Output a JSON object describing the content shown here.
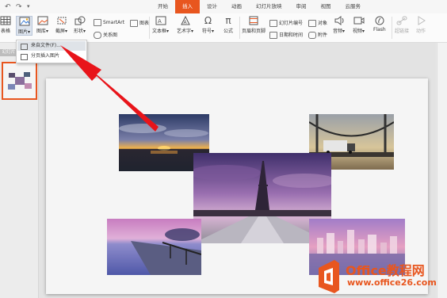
{
  "ribbon_tabs": [
    "开始",
    "插入",
    "设计",
    "动画",
    "幻灯片放映",
    "审阅",
    "视图",
    "云服务"
  ],
  "active_tab": "插入",
  "ribbon": {
    "table": "表格",
    "picture": "图片",
    "gallery": "图库",
    "screenshot": "截屏",
    "shapes": "形状",
    "smartart": "SmartArt",
    "chart": "图表",
    "relation": "关系图",
    "textbox": "文本框",
    "wordart": "艺术字",
    "symbol": "符号",
    "formula": "公式",
    "header_footer": "页眉和页脚",
    "slide_number": "幻灯片编号",
    "datetime": "日期和时间",
    "object": "对象",
    "attachment": "附件",
    "audio": "音频",
    "video": "视频",
    "flash": "Flash",
    "hyperlink": "超链接",
    "action": "动作"
  },
  "left_panel_header": "幻灯片",
  "dropdown": {
    "from_file": "来自文件(F)...",
    "paged_insert": "分页插入图片"
  },
  "watermark": {
    "brand": "Office教程网",
    "url": "www.office26.com"
  },
  "colors": {
    "accent": "#e8561f",
    "arrow": "#e8141a"
  }
}
